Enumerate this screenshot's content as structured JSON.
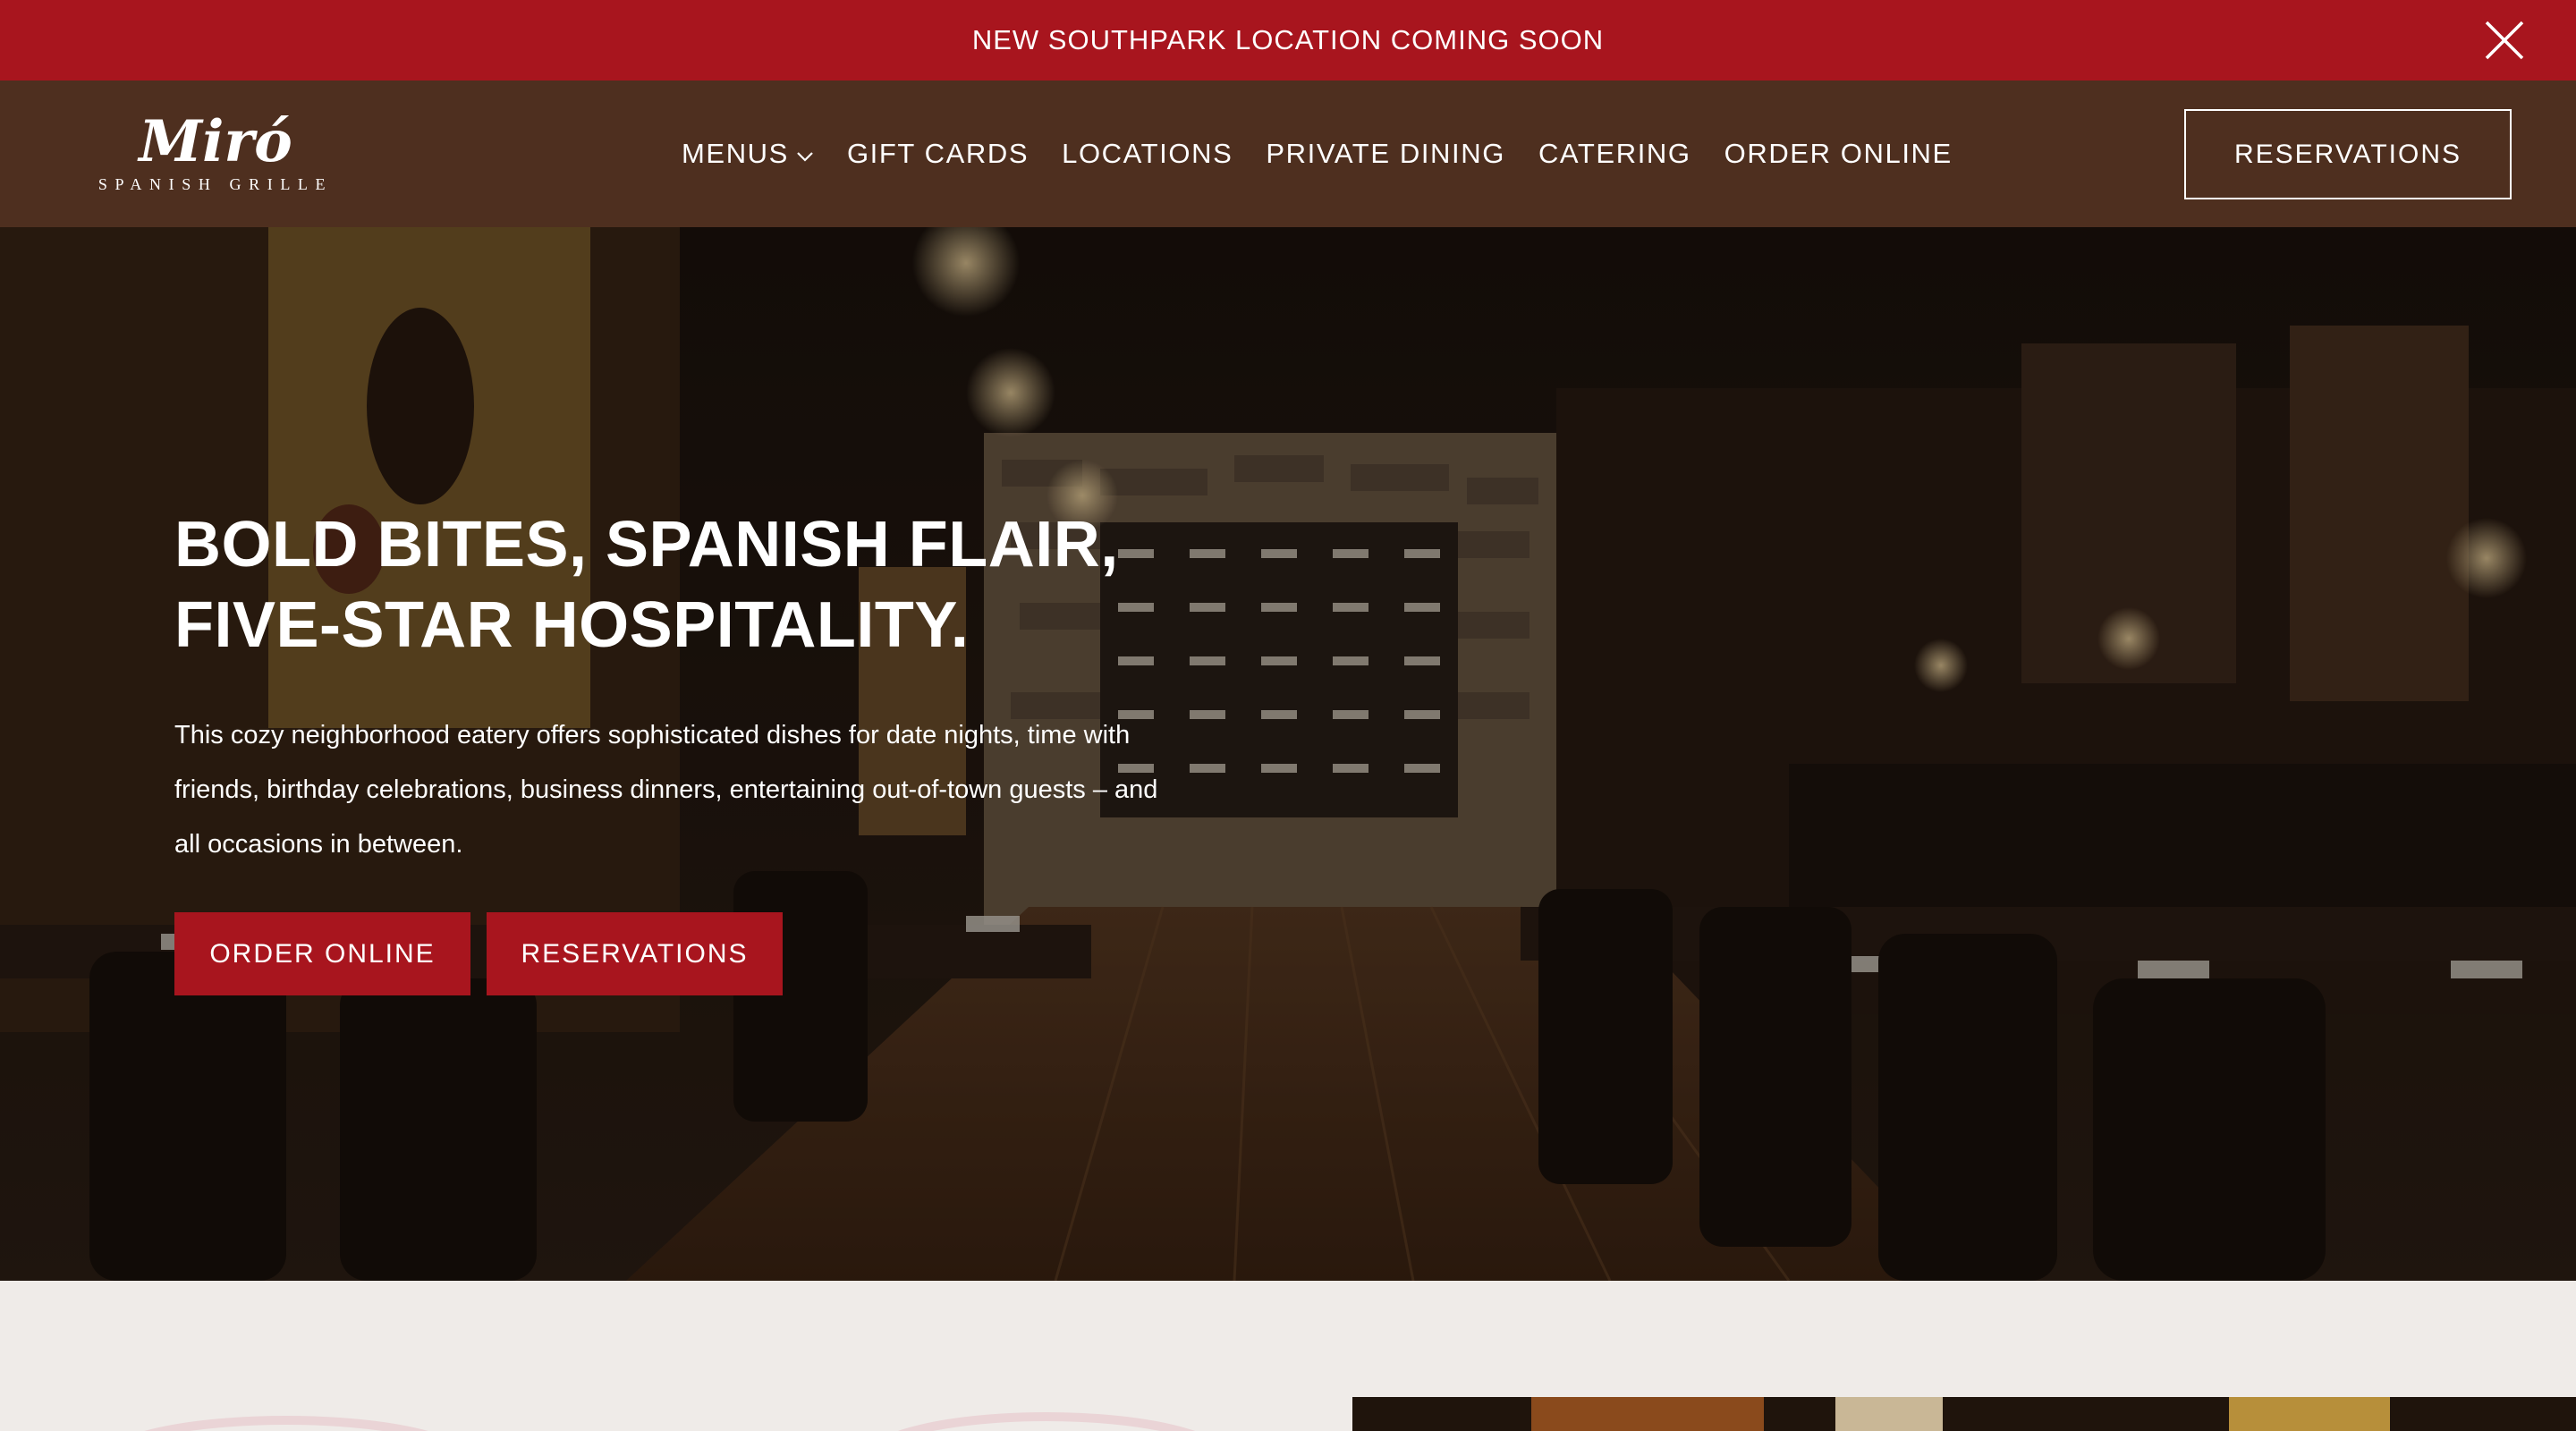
{
  "announcement": {
    "text": "NEW SOUTHPARK LOCATION COMING SOON",
    "close_icon": "close-icon"
  },
  "header": {
    "logo": {
      "script": "Miró",
      "subtitle": "SPANISH GRILLE"
    },
    "nav": [
      {
        "label": "MENUS",
        "has_dropdown": true
      },
      {
        "label": "GIFT CARDS"
      },
      {
        "label": "LOCATIONS"
      },
      {
        "label": "PRIVATE DINING"
      },
      {
        "label": "CATERING"
      },
      {
        "label": "ORDER ONLINE"
      }
    ],
    "reservations_label": "RESERVATIONS"
  },
  "hero": {
    "title_line1": "BOLD BITES, SPANISH FLAIR,",
    "title_line2": "FIVE-STAR HOSPITALITY.",
    "body": "This cozy neighborhood eatery offers sophisticated dishes for date nights, time with friends, birthday celebrations, business dinners, entertaining out-of-town guests – and all occasions in between.",
    "order_button": "ORDER ONLINE",
    "reservations_button": "RESERVATIONS"
  },
  "colors": {
    "brand_red": "#a8151e",
    "header_brown": "#4e2f1f",
    "section_bg": "#efebe8",
    "deco_pink": "#ead4d6"
  }
}
